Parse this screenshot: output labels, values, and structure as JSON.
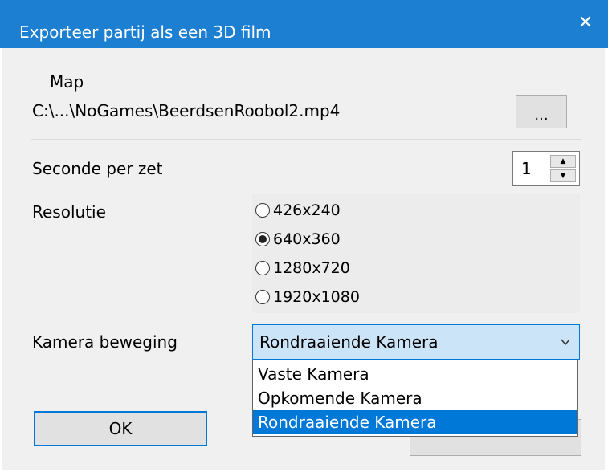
{
  "window": {
    "title": "Exporteer partij als een 3D film",
    "close_glyph": "✕"
  },
  "map": {
    "group_label": "Map",
    "path": "C:\\...\\NoGames\\BeerdsenRoobol2.mp4",
    "browse_label": "..."
  },
  "seconds": {
    "label": "Seconde per zet",
    "value": "1"
  },
  "resolution": {
    "label": "Resolutie",
    "options": [
      "426x240",
      "640x360",
      "1280x720",
      "1920x1080"
    ],
    "selected": "640x360"
  },
  "camera": {
    "label": "Kamera beweging",
    "value": "Rondraaiende Kamera",
    "options": [
      "Vaste Kamera",
      "Opkomende Kamera",
      "Rondraaiende Kamera"
    ],
    "highlighted": "Rondraaiende Kamera"
  },
  "buttons": {
    "ok_label": "OK"
  },
  "colors": {
    "title_bar": "#1c7fd1",
    "accent": "#0078d7"
  }
}
